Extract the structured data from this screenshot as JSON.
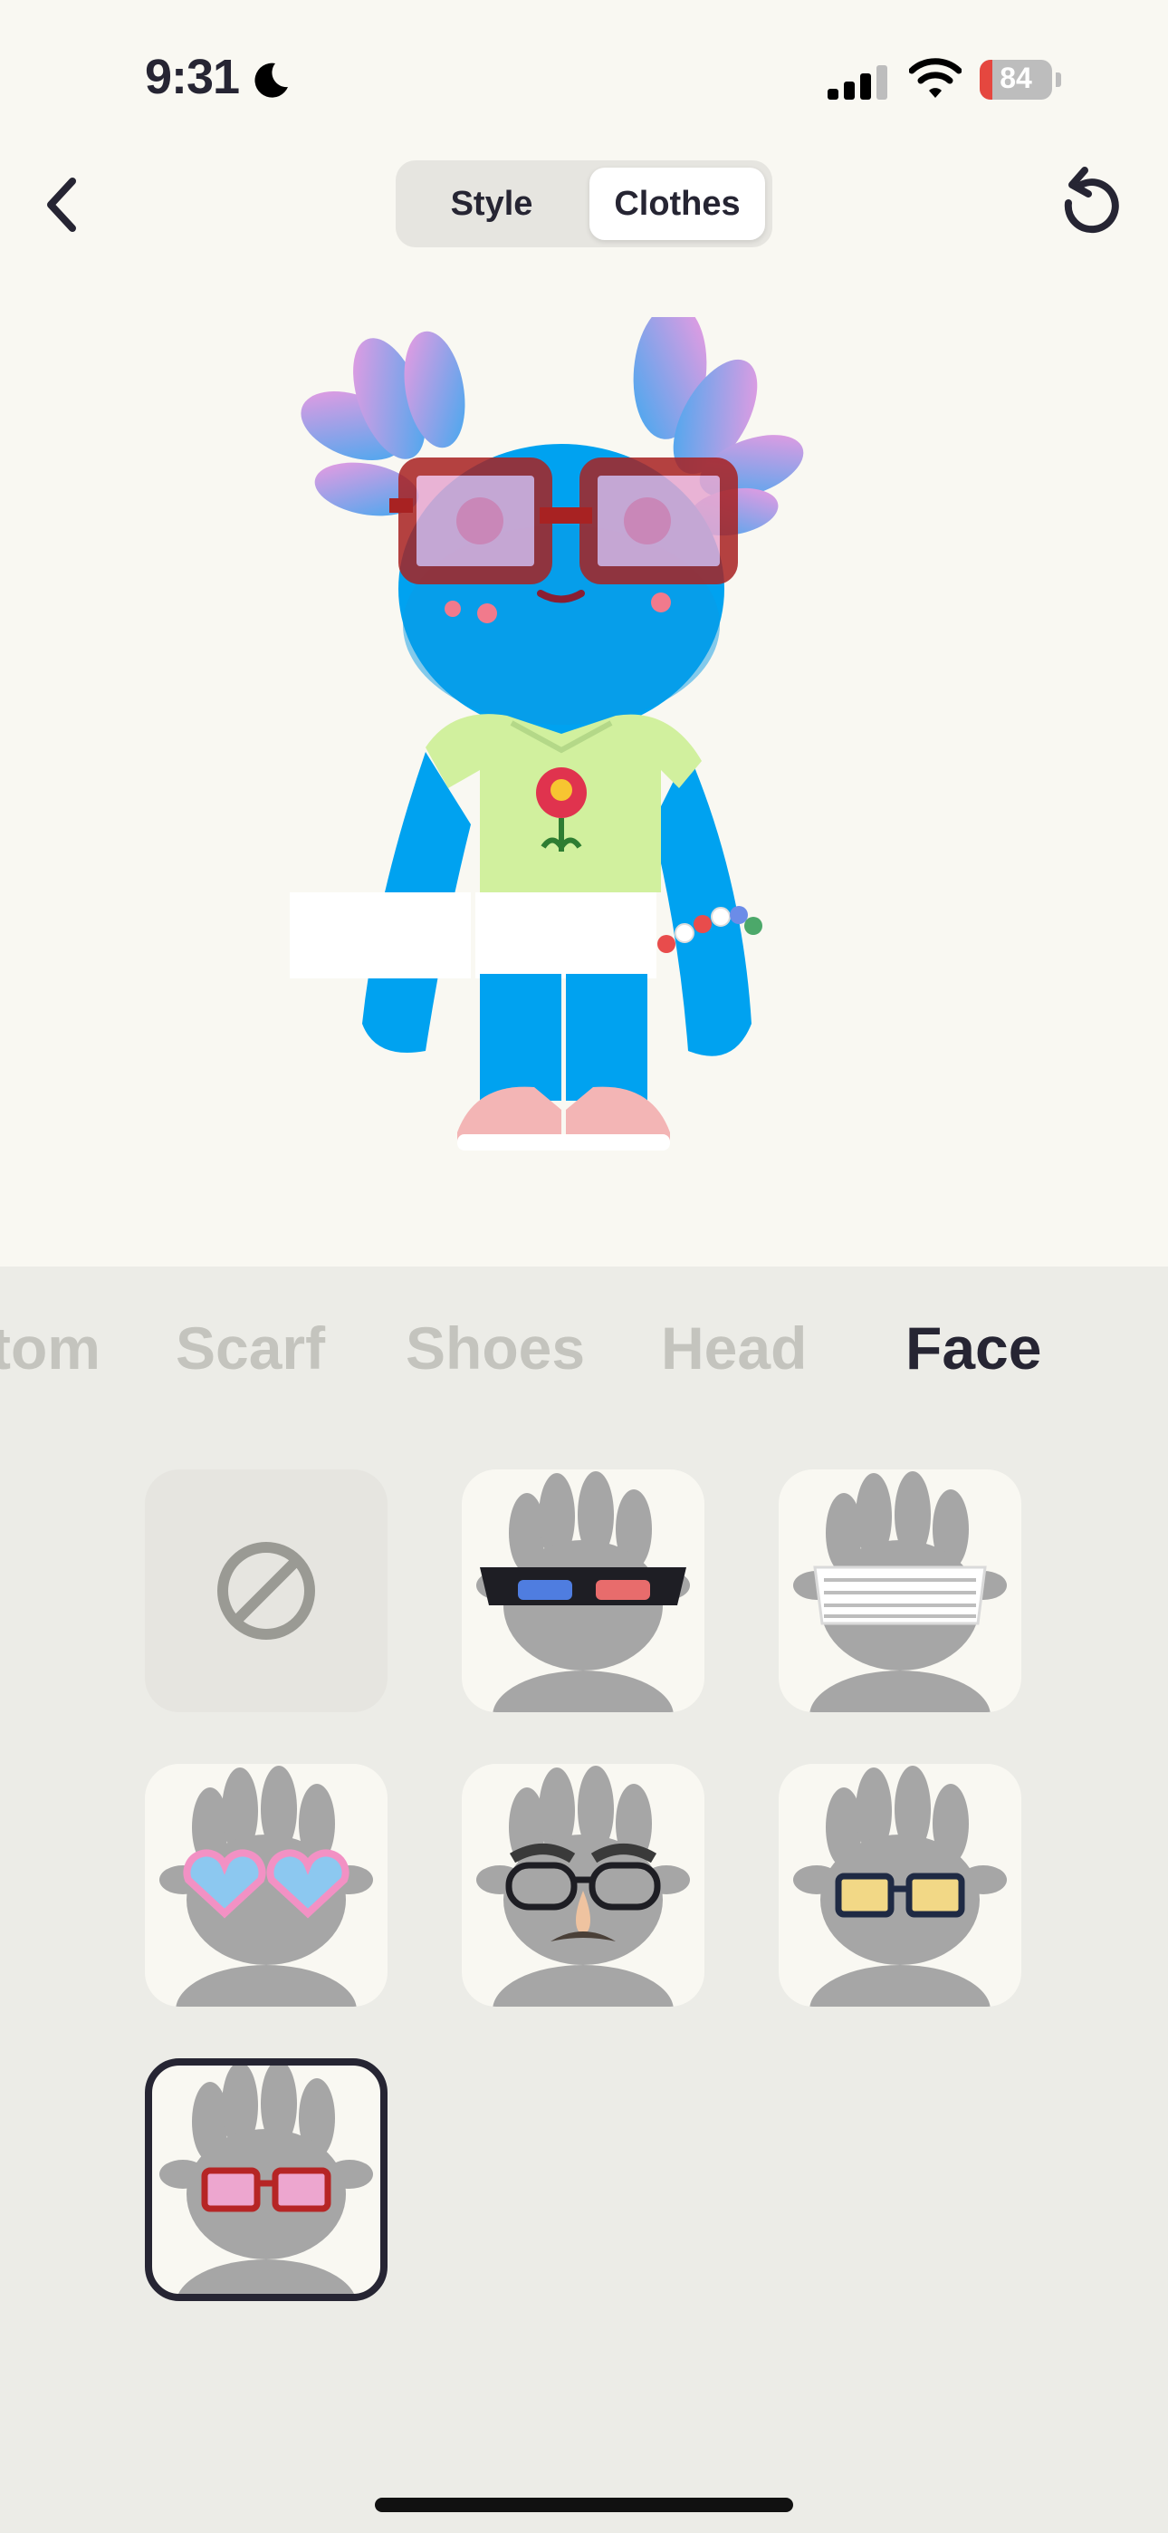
{
  "status_bar": {
    "time": "9:31",
    "battery_level": "84",
    "battery_percent": 0.18
  },
  "header": {
    "segments": [
      {
        "label": "Style",
        "selected": false
      },
      {
        "label": "Clothes",
        "selected": true
      }
    ]
  },
  "categories": [
    {
      "label": "tom",
      "active": false
    },
    {
      "label": "Scarf",
      "active": false
    },
    {
      "label": "Shoes",
      "active": false
    },
    {
      "label": "Head",
      "active": false
    },
    {
      "label": "Face",
      "active": true
    }
  ],
  "face_items": [
    {
      "name": "none",
      "icon": "none-icon"
    },
    {
      "name": "3d-glasses",
      "icon": "3d-glasses-icon"
    },
    {
      "name": "shutter-shades",
      "icon": "shutter-shades-icon"
    },
    {
      "name": "heart-glasses",
      "icon": "heart-glasses-icon"
    },
    {
      "name": "disguise-glasses",
      "icon": "disguise-glasses-icon"
    },
    {
      "name": "yellow-glasses",
      "icon": "yellow-glasses-icon"
    },
    {
      "name": "red-square-glasses",
      "icon": "red-square-glasses-icon",
      "selected": true
    }
  ],
  "colors": {
    "background_top": "#F9F8F2",
    "background_bottom": "#ECECE7",
    "text_dark": "#262533",
    "tab_inactive": "#C4C4BE",
    "avatar_body": "#00A2F0",
    "avatar_glasses": "#A82222"
  }
}
